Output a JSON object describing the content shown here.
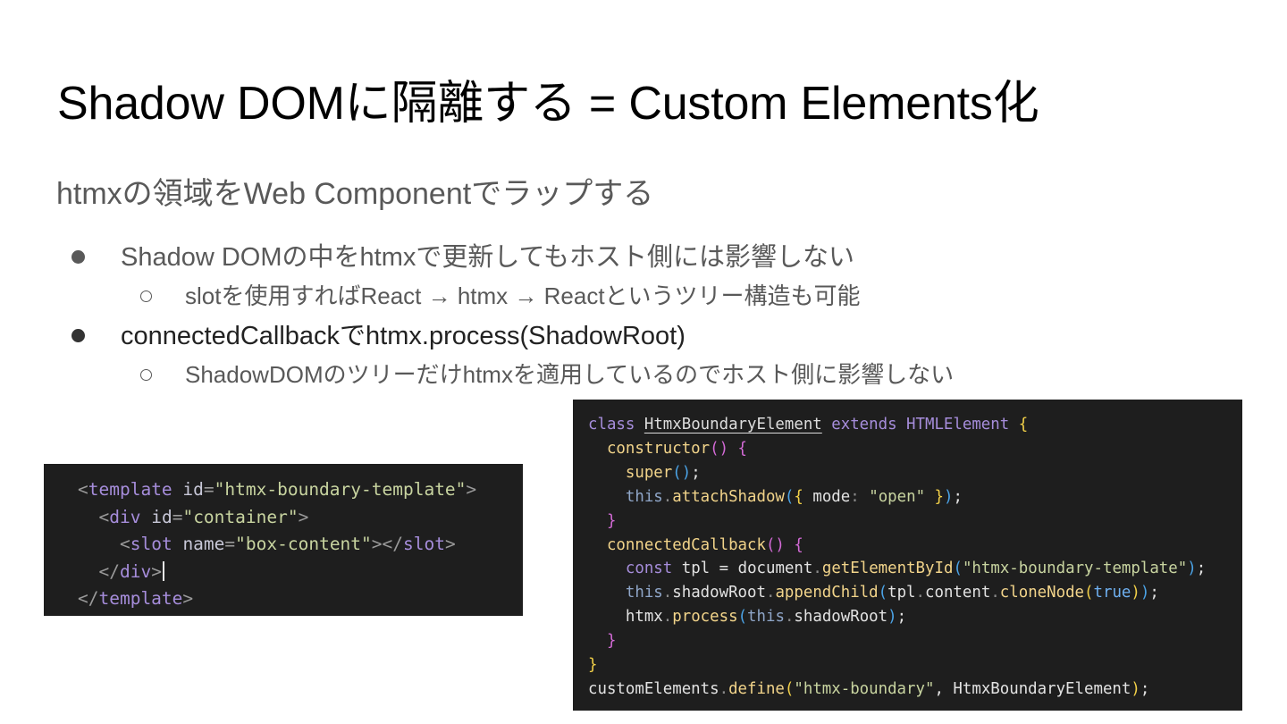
{
  "slide": {
    "title": "Shadow DOMに隔離する = Custom Elements化",
    "subtitle": "htmxの領域をWeb Componentでラップする",
    "bullets": [
      {
        "text": "Shadow DOMの中をhtmxで更新してもホスト側には影響しない",
        "sub": "slotを使用すればReact → htmx → Reactというツリー構造も可能"
      },
      {
        "text": "connectedCallbackでhtmx.process(ShadowRoot)",
        "sub": "ShadowDOMのツリーだけhtmxを適用しているのでホスト側に影響しない"
      }
    ]
  },
  "code_template": {
    "template_tag": "template",
    "id_attr": "id",
    "template_id": "\"htmx-boundary-template\"",
    "div_tag": "div",
    "div_id": "\"container\"",
    "slot_tag": "slot",
    "name_attr": "name",
    "slot_name": "\"box-content\""
  },
  "code_class": {
    "kw_class": "class",
    "class_name": "HtmxBoundaryElement",
    "kw_extends": "extends",
    "base_class": "HTMLElement",
    "constructor": "constructor",
    "super": "super",
    "kw_this": "this",
    "attach_shadow": "attachShadow",
    "mode_key": "mode",
    "mode_value": "\"open\"",
    "connected_callback": "connectedCallback",
    "kw_const": "const",
    "tpl_var": "tpl",
    "document": "document",
    "get_element_by_id": "getElementById",
    "template_id": "\"htmx-boundary-template\"",
    "shadow_root": "shadowRoot",
    "append_child": "appendChild",
    "content": "content",
    "clone_node": "cloneNode",
    "true_value": "true",
    "htmx": "htmx",
    "process": "process",
    "custom_elements": "customElements",
    "define": "define",
    "element_name": "\"htmx-boundary\""
  }
}
